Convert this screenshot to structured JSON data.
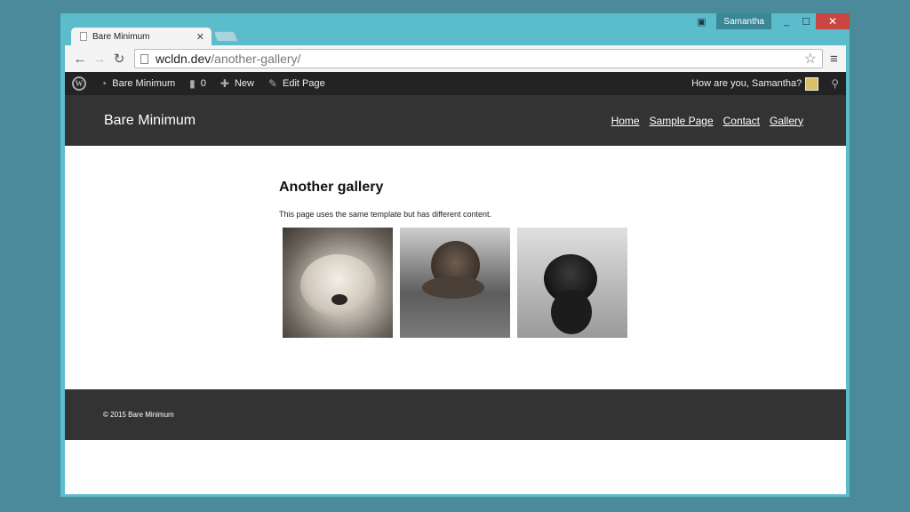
{
  "window": {
    "user_name": "Samantha",
    "tab_title": "Bare Minimum",
    "url_host": "wcldn.dev",
    "url_path": "/another-gallery/"
  },
  "adminbar": {
    "site_name": "Bare Minimum",
    "comments_count": "0",
    "new_label": "New",
    "edit_label": "Edit Page",
    "greeting": "How are you, Samantha?"
  },
  "site": {
    "title": "Bare Minimum",
    "nav": [
      "Home",
      "Sample Page",
      "Contact",
      "Gallery"
    ]
  },
  "page": {
    "title": "Another gallery",
    "text": "This page uses the same template but has different content."
  },
  "footer": {
    "text": "© 2015 Bare Minimum"
  },
  "colors": {
    "admin_bar": "#232323",
    "header_bg": "#333333",
    "window_frame": "#5bbccc",
    "close_button": "#c9453f"
  }
}
